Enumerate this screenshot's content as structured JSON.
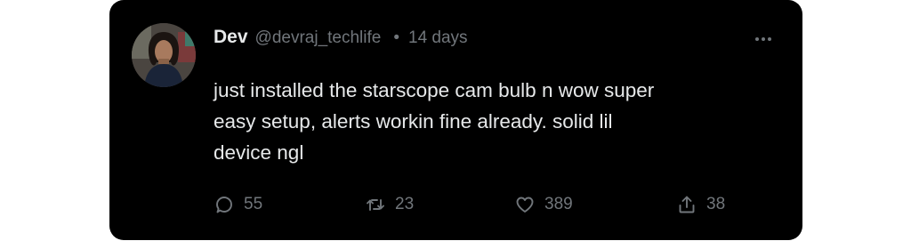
{
  "post": {
    "author_name": "Dev",
    "handle": "@devraj_techlife",
    "separator": "•",
    "timestamp": "14 days",
    "text": "just installed the starscope cam bulb n wow super\neasy setup, alerts workin fine already. solid lil\ndevice ngl",
    "more_icon": "more-horizontal-icon",
    "avatar_icon": "user-avatar"
  },
  "actions": {
    "reply": {
      "icon": "reply-icon",
      "count": "55"
    },
    "repost": {
      "icon": "repost-icon",
      "count": "23"
    },
    "like": {
      "icon": "heart-icon",
      "count": "389"
    },
    "share": {
      "icon": "share-icon",
      "count": "38"
    }
  },
  "colors": {
    "background": "#000000",
    "primary_text": "#e7e9ea",
    "secondary_text": "#71767b"
  }
}
